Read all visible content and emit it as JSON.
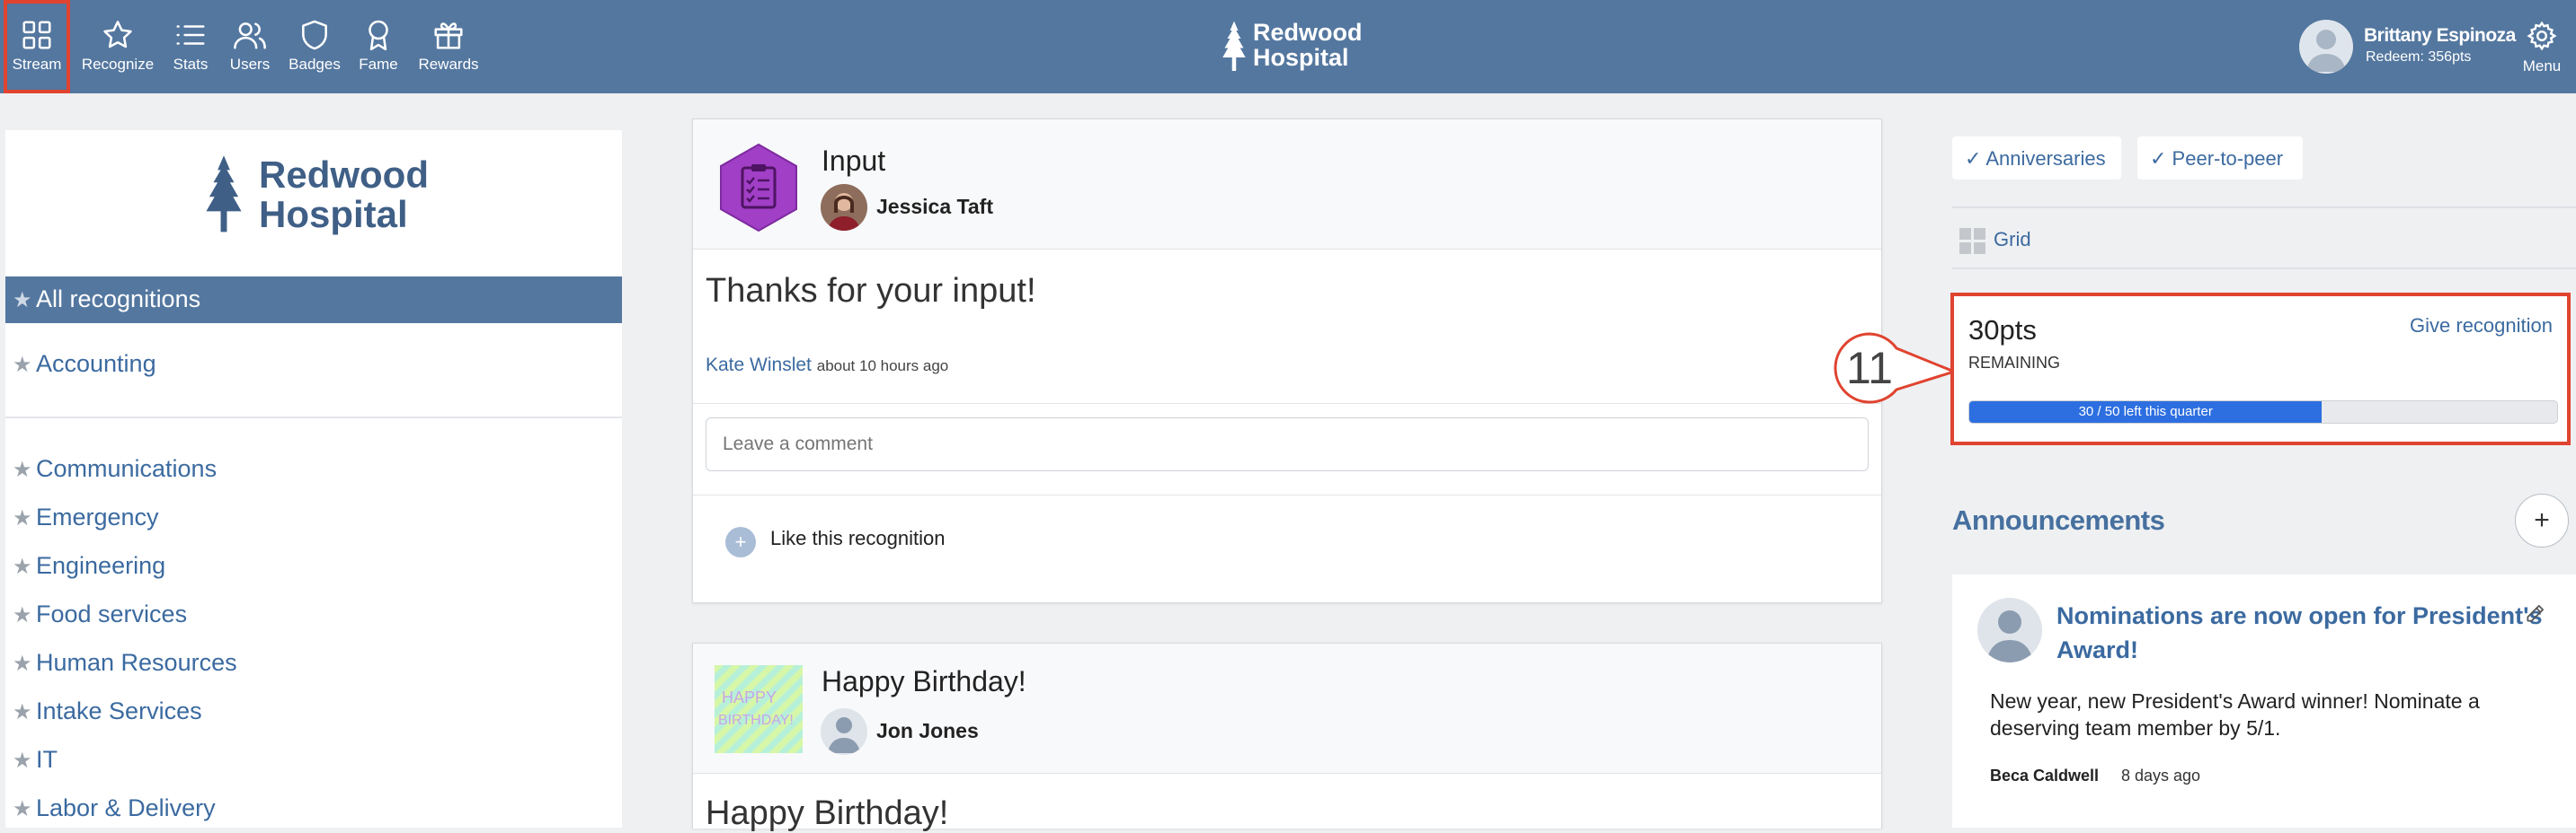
{
  "nav": {
    "items": [
      {
        "label": "Stream",
        "icon": "grid-icon"
      },
      {
        "label": "Recognize",
        "icon": "star-icon"
      },
      {
        "label": "Stats",
        "icon": "list-icon"
      },
      {
        "label": "Users",
        "icon": "users-icon"
      },
      {
        "label": "Badges",
        "icon": "shield-icon"
      },
      {
        "label": "Fame",
        "icon": "award-icon"
      },
      {
        "label": "Rewards",
        "icon": "gift-icon"
      }
    ],
    "active": "Stream",
    "brand_line1": "Redwood",
    "brand_line2": "Hospital",
    "user_name": "Brittany Espinoza",
    "user_redeem": "Redeem: 356pts",
    "menu_label": "Menu"
  },
  "sidebar": {
    "brand_line1": "Redwood",
    "brand_line2": "Hospital",
    "active_item": "All recognitions",
    "top_items": [
      "All recognitions",
      "Accounting"
    ],
    "items": [
      "Communications",
      "Emergency",
      "Engineering",
      "Food services",
      "Human Resources",
      "Intake Services",
      "IT",
      "Labor & Delivery"
    ]
  },
  "feed": [
    {
      "badge": "Input",
      "person": "Jessica Taft",
      "message": "Thanks for your input!",
      "from": "Kate Winslet",
      "time": "about 10 hours ago",
      "comment_placeholder": "Leave a comment",
      "like_label": "Like this recognition"
    },
    {
      "badge": "Happy Birthday!",
      "person": "Jon Jones",
      "message": "Happy Birthday!",
      "image_text": "HAPPY BIRTHDAY!"
    }
  ],
  "right": {
    "filters": [
      "✓ Anniversaries",
      "✓ Peer-to-peer"
    ],
    "grid_label": "Grid",
    "points": "30pts",
    "remaining_label": "REMAINING",
    "give_label": "Give recognition",
    "progress_text": "30 / 50 left this quarter",
    "progress_fraction": 0.6,
    "step_number": "11",
    "announcements_title": "Announcements",
    "announcement": {
      "title_line1": "Nominations are now open for President's",
      "title_line2": "Award!",
      "body_line1": "New year, new President's Award winner! Nominate a",
      "body_line2": "deserving team member by 5/1.",
      "author": "Beca Caldwell",
      "date": "8 days ago"
    }
  },
  "colors": {
    "topbar": "#54779f",
    "accent_link": "#3b6aa0",
    "highlight": "#e0432f",
    "progress": "#2d6fe0",
    "badge_purple": "#a13fc6"
  }
}
